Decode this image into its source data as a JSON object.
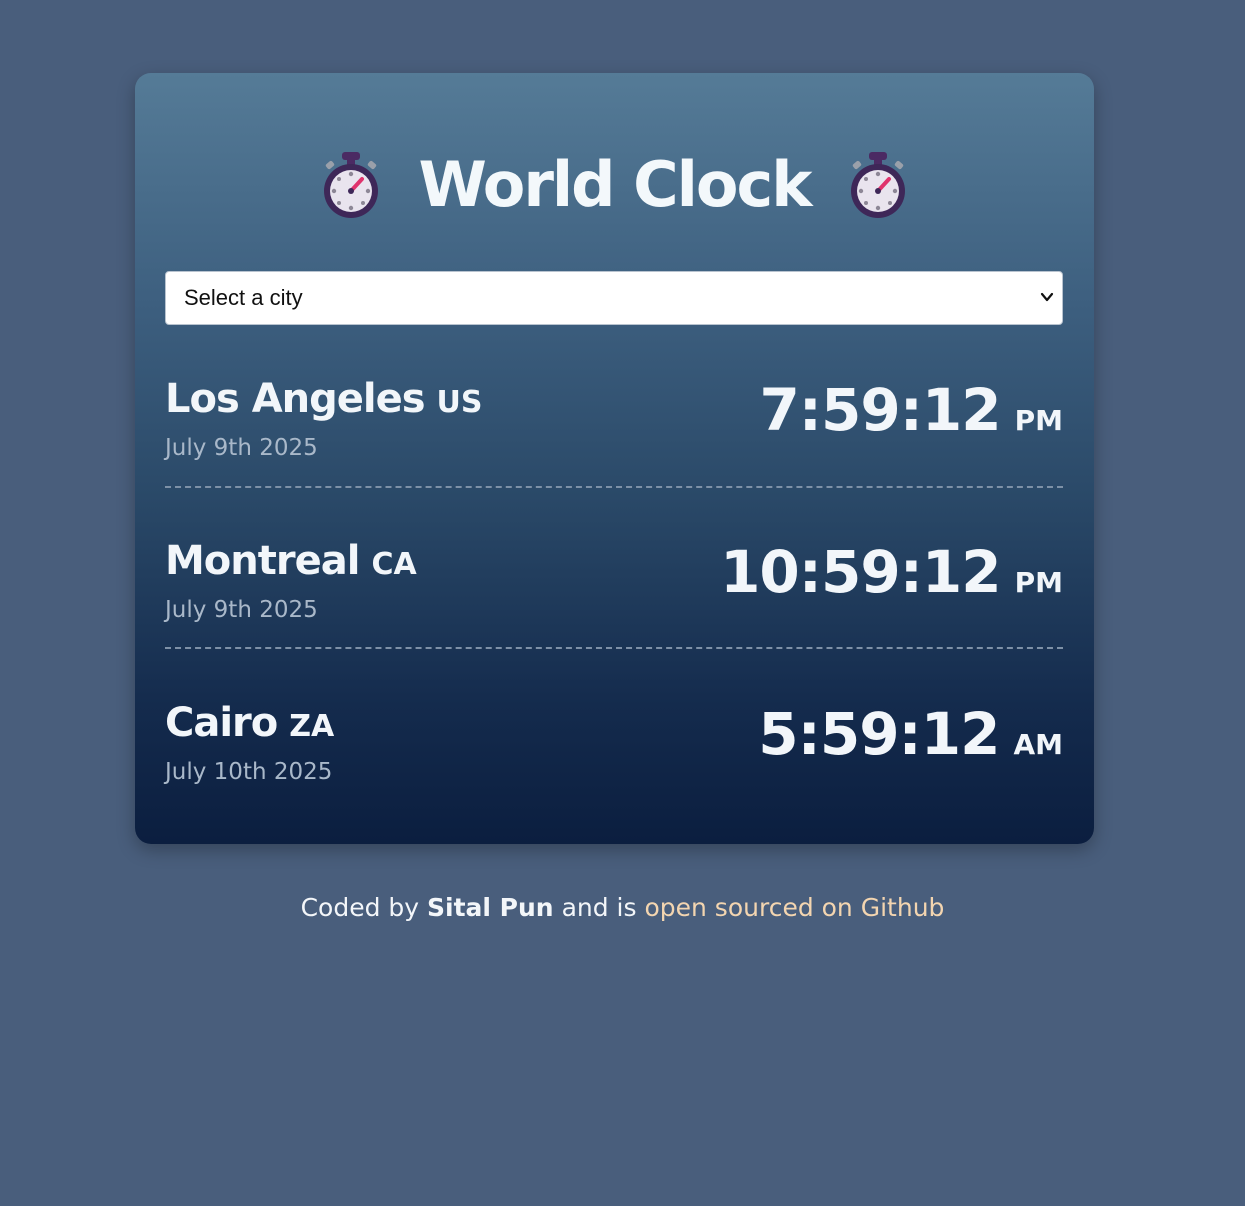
{
  "app": {
    "title": "World Clock",
    "icons": [
      "stopwatch-icon",
      "stopwatch-icon"
    ]
  },
  "city_select": {
    "value": "Select a city"
  },
  "cities": [
    {
      "name": "Los Angeles",
      "country": "US",
      "date": "July 9th 2025",
      "time": "7:59:12",
      "ampm": "PM"
    },
    {
      "name": "Montreal",
      "country": "CA",
      "date": "July 9th 2025",
      "time": "10:59:12",
      "ampm": "PM"
    },
    {
      "name": "Cairo",
      "country": "ZA",
      "date": "July 10th 2025",
      "time": "5:59:12",
      "ampm": "AM"
    }
  ],
  "footer": {
    "prefix": "Coded by",
    "author": "Sital Pun",
    "middle": "and is",
    "link_text": "open sourced on Github"
  },
  "colors": {
    "background": "#495e7c",
    "card_top": "#557b97",
    "card_bottom": "#0b1e3f",
    "link": "#f3d5b0"
  }
}
